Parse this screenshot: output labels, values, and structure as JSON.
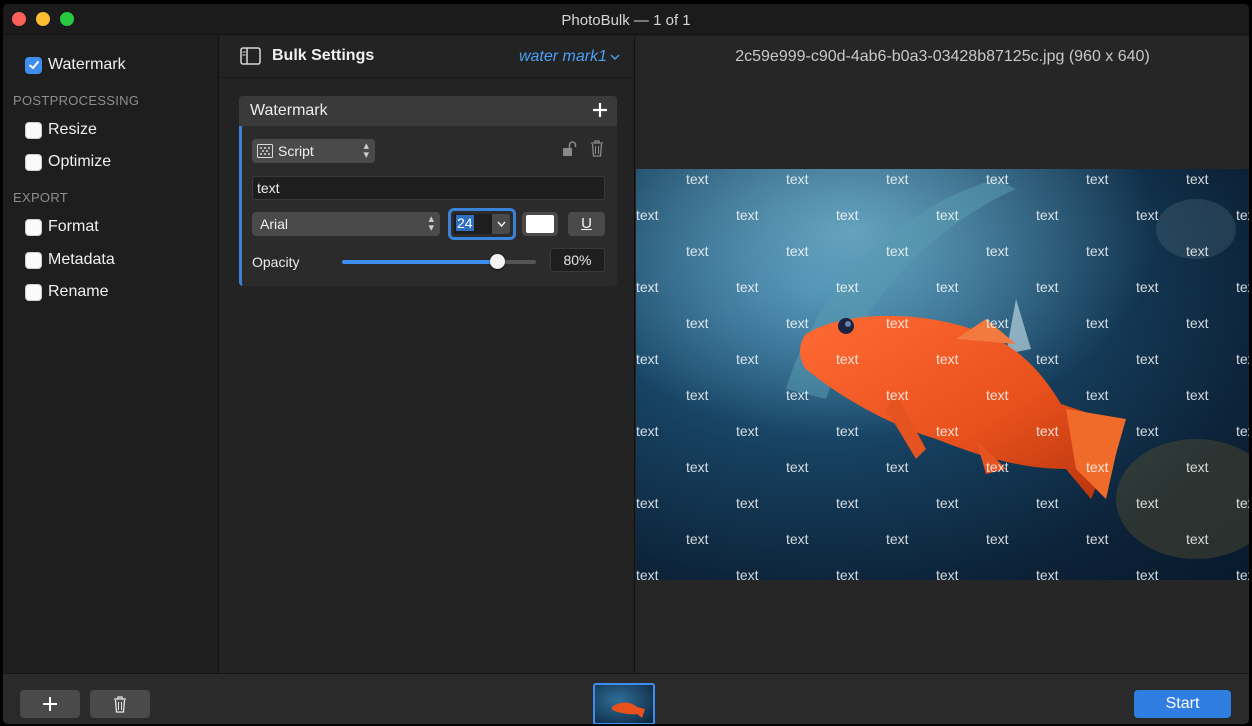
{
  "window": {
    "title": "PhotoBulk — 1 of 1"
  },
  "sidebar": {
    "watermark": {
      "label": "Watermark",
      "checked": true
    },
    "postprocessing_label": "POSTPROCESSING",
    "resize": {
      "label": "Resize",
      "checked": false
    },
    "optimize": {
      "label": "Optimize",
      "checked": false
    },
    "export_label": "EXPORT",
    "format": {
      "label": "Format",
      "checked": false
    },
    "metadata": {
      "label": "Metadata",
      "checked": false
    },
    "rename": {
      "label": "Rename",
      "checked": false
    }
  },
  "settings": {
    "title": "Bulk Settings",
    "preset": "water mark1"
  },
  "watermark_panel": {
    "header": "Watermark",
    "add_icon": "plus-icon",
    "type": "Script",
    "text_value": "text",
    "font": "Arial",
    "font_size": "24",
    "color": "#ffffff",
    "underline_label": "U",
    "opacity_label": "Opacity",
    "opacity_value": "80%",
    "opacity_fraction": 0.8
  },
  "preview": {
    "filename": "2c59e999-c90d-4ab6-b0a3-03428b87125c.jpg (960 x 640)",
    "watermark_word": "text"
  },
  "bottom": {
    "add_icon": "plus-icon",
    "delete_icon": "trash-icon",
    "start_label": "Start"
  },
  "colors": {
    "accent": "#3d8ef0",
    "start_button": "#2f7de1",
    "close": "#fc5f57",
    "minimize": "#fdbd2e",
    "maximize": "#28c840"
  }
}
